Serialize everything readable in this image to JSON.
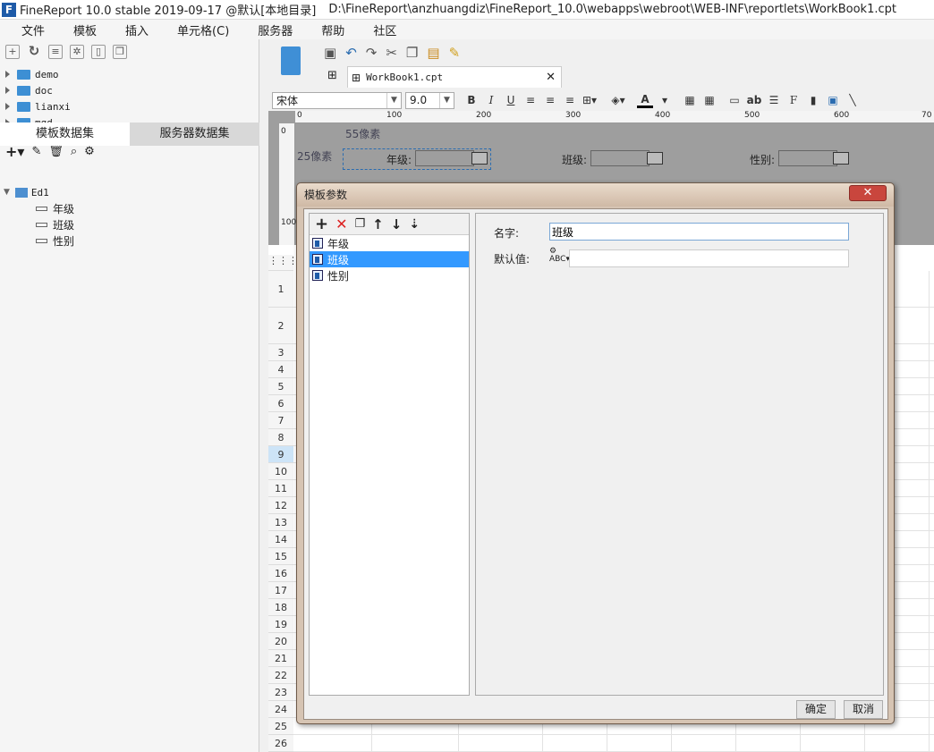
{
  "window": {
    "title": "FineReport 10.0 stable 2019-09-17 @默认[本地目录]",
    "path": "D:\\FineReport\\anzhuangdiz\\FineReport_10.0\\webapps\\webroot\\WEB-INF\\reportlets\\WorkBook1.cpt"
  },
  "menu": [
    "文件",
    "模板",
    "插入",
    "单元格(C)",
    "服务器",
    "帮助",
    "社区"
  ],
  "file_tree": [
    "demo",
    "doc",
    "lianxi",
    "mgd"
  ],
  "dataset_tabs": {
    "template": "模板数据集",
    "server": "服务器数据集"
  },
  "dataset": {
    "name": "Ed1",
    "fields": [
      "年级",
      "班级",
      "性别"
    ]
  },
  "editor_tab": "WorkBook1.cpt",
  "format": {
    "font": "宋体",
    "size": "9.0",
    "bold": "B",
    "italic": "I",
    "underline": "U",
    "text_color": "A",
    "ab": "ab"
  },
  "ruler": {
    "h": [
      "0",
      "100",
      "200",
      "300",
      "400",
      "500",
      "600",
      "70"
    ],
    "v": [
      "0",
      "100"
    ]
  },
  "param_pane": {
    "hint_55": "55像素",
    "hint_25": "25像素",
    "labels": [
      "年级:",
      "班级:",
      "性别:"
    ]
  },
  "rows": [
    "1",
    "2",
    "3",
    "4",
    "5",
    "6",
    "7",
    "8",
    "9",
    "10",
    "11",
    "12",
    "13",
    "14",
    "15",
    "16",
    "17",
    "18",
    "19",
    "20",
    "21",
    "22",
    "23",
    "24",
    "25",
    "26"
  ],
  "dialog": {
    "title": "模板参数",
    "params": [
      "年级",
      "班级",
      "性别"
    ],
    "selected_index": 1,
    "name_label": "名字:",
    "name_value": "班级",
    "default_label": "默认值:",
    "default_value": "",
    "ok": "确定",
    "cancel": "取消"
  }
}
